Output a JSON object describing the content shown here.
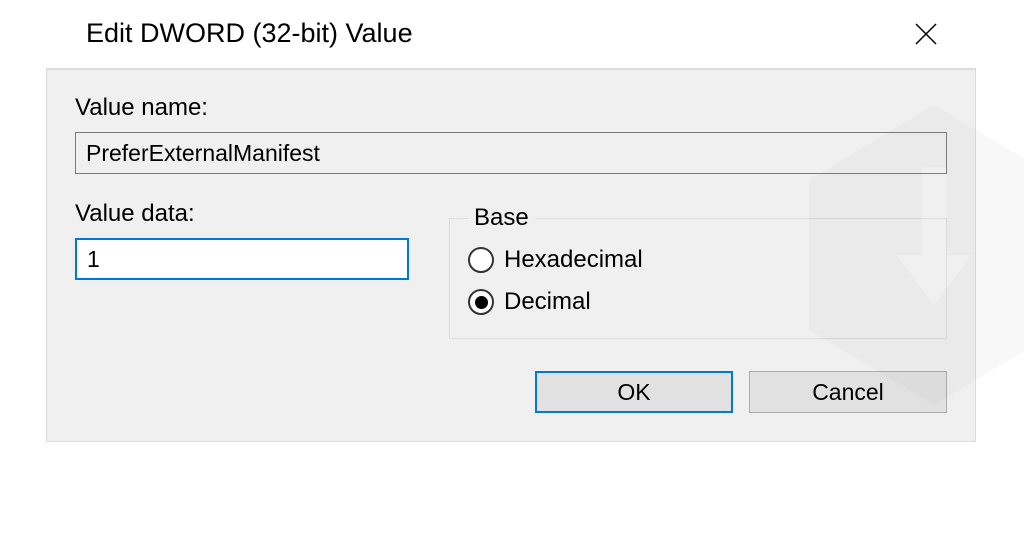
{
  "dialog": {
    "title": "Edit DWORD (32-bit) Value",
    "value_name_label": "Value name:",
    "value_name": "PreferExternalManifest",
    "value_data_label": "Value data:",
    "value_data": "1",
    "base": {
      "legend": "Base",
      "options": [
        {
          "label": "Hexadecimal",
          "selected": false
        },
        {
          "label": "Decimal",
          "selected": true
        }
      ]
    },
    "buttons": {
      "ok": "OK",
      "cancel": "Cancel"
    }
  }
}
